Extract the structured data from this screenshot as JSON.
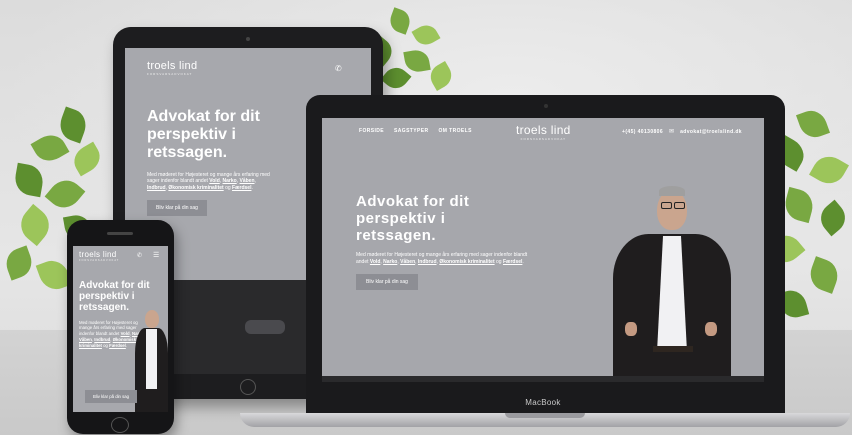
{
  "site": {
    "logo": "troels lind",
    "logo_sub": "FORSVARSADVOKAT",
    "nav": [
      "FORSIDE",
      "SAGSTYPER",
      "OM TROELS"
    ],
    "phone": "+(45) 40130806",
    "email": "advokat@troelslind.dk",
    "hero_title_lines": [
      "Advokat for dit",
      "perspektiv i",
      "retssagen."
    ],
    "hero_text_prefix": "Med møderet for Højesteret og mange års erfaring med sager indenfor blandt andet ",
    "hero_keywords": [
      "Vold",
      "Narko",
      "Våben",
      "Indbrud",
      "Økonomisk kriminalitet"
    ],
    "hero_text_join": "og",
    "hero_text_last": "Færdsel",
    "cta_label": "Bliv klar på din sag"
  },
  "device_label": "MacBook",
  "icons": {
    "phone_icon": "phone",
    "email_icon": "envelope",
    "menu_icon": "hamburger"
  },
  "colors": {
    "site_background": "#a7a8ad",
    "cta_background": "#8d8e94",
    "text": "#ffffff",
    "device_frame": "#1a1a1c"
  }
}
